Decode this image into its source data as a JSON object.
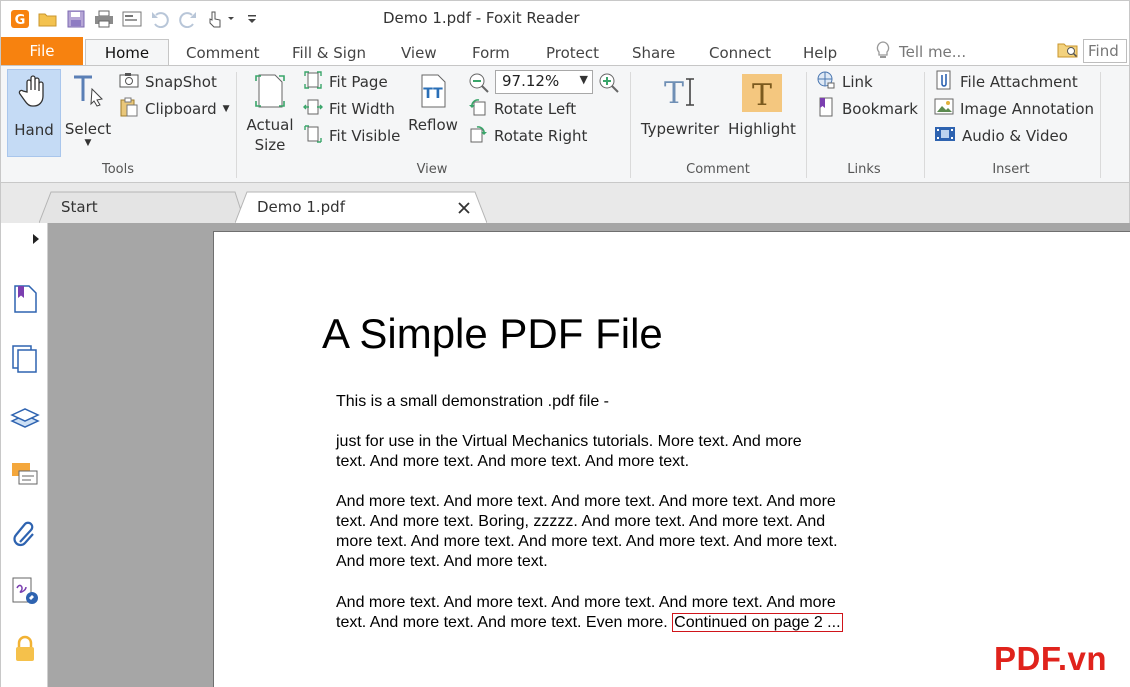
{
  "window": {
    "title": "Demo 1.pdf - Foxit Reader"
  },
  "ribbon_tabs": [
    {
      "label": "File"
    },
    {
      "label": "Home"
    },
    {
      "label": "Comment"
    },
    {
      "label": "Fill & Sign"
    },
    {
      "label": "View"
    },
    {
      "label": "Form"
    },
    {
      "label": "Protect"
    },
    {
      "label": "Share"
    },
    {
      "label": "Connect"
    },
    {
      "label": "Help"
    }
  ],
  "active_tab": "Home",
  "tell_me": {
    "placeholder": "Tell me..."
  },
  "find": {
    "placeholder": "Find"
  },
  "groups": {
    "tools": {
      "label": "Tools",
      "hand": "Hand",
      "select": "Select",
      "snapshot": "SnapShot",
      "clipboard": "Clipboard"
    },
    "view": {
      "label": "View",
      "actual_size_line1": "Actual",
      "actual_size_line2": "Size",
      "fit_page": "Fit Page",
      "fit_width": "Fit Width",
      "fit_visible": "Fit Visible",
      "reflow": "Reflow",
      "zoom_value": "97.12%",
      "rotate_left": "Rotate Left",
      "rotate_right": "Rotate Right"
    },
    "comment": {
      "label": "Comment",
      "typewriter": "Typewriter",
      "highlight": "Highlight"
    },
    "links": {
      "label": "Links",
      "link": "Link",
      "bookmark": "Bookmark"
    },
    "insert": {
      "label": "Insert",
      "file_attachment": "File Attachment",
      "image_annotation": "Image Annotation",
      "audio_video": "Audio & Video"
    }
  },
  "doc_tabs": [
    {
      "label": "Start"
    },
    {
      "label": "Demo 1.pdf"
    }
  ],
  "pdf": {
    "title": "A Simple PDF File",
    "lines": [
      "This is a small demonstration .pdf file -",
      "just for use in the Virtual Mechanics tutorials. More text. And more",
      "text. And more text. And more text. And more text.",
      "And more text. And more text. And more text. And more text. And more",
      "text. And more text. Boring, zzzzz. And more text. And more text. And",
      "more text. And more text. And more text. And more text. And more text.",
      "And more text. And more text.",
      "And more text. And more text. And more text. And more text. And more",
      "text. And more text. And more text. Even more. "
    ],
    "continued": "Continued on page 2 ..."
  },
  "watermark": "PDF.vn",
  "colors": {
    "accent": "#f7820f",
    "hand_selected": "#c5dbf5",
    "link_box": "#d0141a",
    "watermark": "#e0231c"
  }
}
